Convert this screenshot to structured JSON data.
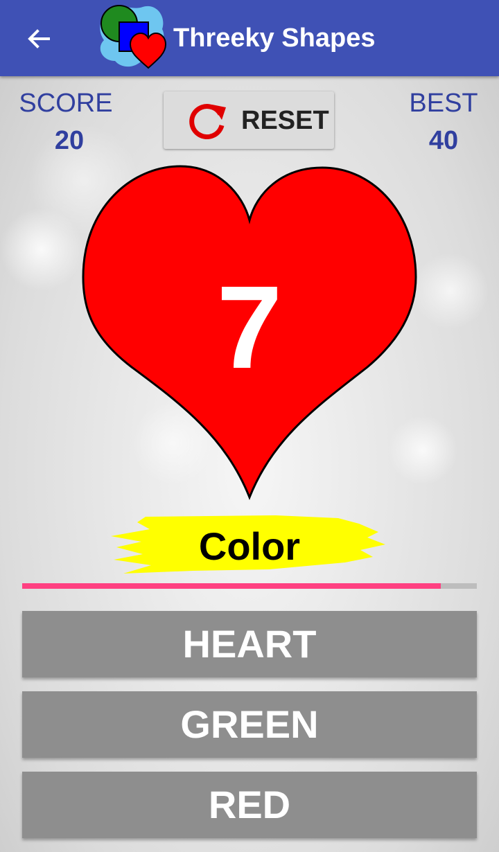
{
  "app_bar": {
    "title": "Threeky Shapes",
    "back_icon": "arrow-left-icon",
    "logo_icon": "shapes-logo-icon",
    "background_color": "#3f51b5"
  },
  "score": {
    "label": "SCORE",
    "value": "20"
  },
  "best": {
    "label": "BEST",
    "value": "40"
  },
  "reset_button": {
    "label": "RESET",
    "icon": "refresh-icon",
    "icon_color": "#e00000"
  },
  "card": {
    "shape": "heart",
    "shape_color": "#ff0000",
    "number": "7"
  },
  "prompt": {
    "label": "Color",
    "highlight_color": "#ffff00"
  },
  "timer": {
    "progress": 0.92,
    "fill_color": "#ff4081"
  },
  "answers": [
    {
      "label": "HEART"
    },
    {
      "label": "GREEN"
    },
    {
      "label": "RED"
    }
  ]
}
